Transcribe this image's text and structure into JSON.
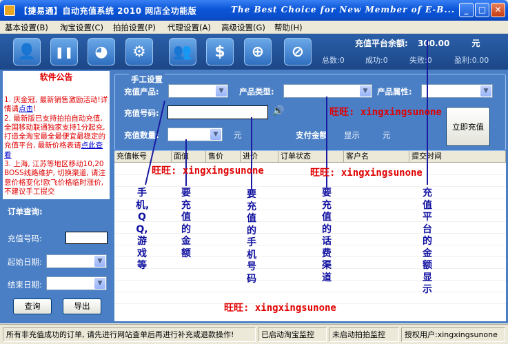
{
  "window": {
    "title": "【捷易通】自动充值系统 2010 网店全功能版",
    "tagline": "The Best Choice for New Member of E-B...",
    "min": "_",
    "max": "□",
    "close": "✕"
  },
  "menu": [
    "基本设置(B)",
    "淘宝设置(C)",
    "拍拍设置(P)",
    "代理设置(A)",
    "高级设置(G)",
    "帮助(H)"
  ],
  "toolbar": {
    "icons": [
      "user-icon",
      "pause-icon",
      "qq-icon",
      "settings-icon",
      "users-icon",
      "dollar-icon",
      "zoom-icon",
      "stop-icon"
    ],
    "glyphs": [
      "👤",
      "❚❚",
      "◕",
      "⚙",
      "👥",
      "$",
      "⊕",
      "⊘"
    ],
    "balance_label": "充值平台余额:",
    "balance_value": "300.00",
    "balance_unit": "元",
    "stats": [
      "总数:0",
      "成功:0",
      "失败:0",
      "盈利:0.00"
    ]
  },
  "notice": {
    "title": "软件公告",
    "line1a": "1. 庆金冠, 最新销售激励活动!详情请",
    "line1link": "点击",
    "line1b": "!",
    "line2a": "2. 最新版已支持拍拍自动充值,全国移动联通独家支持1分起充, 打造全淘宝最全最便宜最稳定的充值平台, 最新价格表请",
    "line2link": "点此查看",
    "line3": "3. 上海, 江苏等地区移动10,20 BOSS线路维护, 切换渠道, 请注意价格变化!欧飞价格临时涨价, 不建议手工提交"
  },
  "query": {
    "title": "订单查询:",
    "phone_label": "充值号码:",
    "start_label": "起始日期:",
    "end_label": "结束日期:",
    "search": "查询",
    "export": "导出"
  },
  "form": {
    "group_title": "手工设置",
    "product_label": "充值产品:",
    "type_label": "产品类型:",
    "attr_label": "产品属性:",
    "phone_label": "充值号码:",
    "qty_label": "充值数量:",
    "qty_unit": "元",
    "pay_label": "支付金额",
    "pay_show": "显示",
    "pay_unit": "元",
    "submit": "立即充值"
  },
  "table": {
    "columns": [
      "充值帐号",
      "面值",
      "售价",
      "进价",
      "订单状态",
      "客户名",
      "提交时间"
    ]
  },
  "annotations": {
    "wangwang1": "旺旺: xingxingsunone",
    "wangwang2": "旺旺: xingxingsunone",
    "wangwang3": "旺旺: xingxingsunone",
    "wangwang4": "旺旺: xingxingsunone",
    "v1": "手机,QQ,游戏等",
    "v2": "要充值的金额",
    "v3": "要充值的手机号码",
    "v4": "要充值的话费渠道",
    "v5": "充值平台的金额显示"
  },
  "status": {
    "message": "所有非充值成功的订单, 请先进行网站查单后再进行补充或退款操作!",
    "taobao": "已启动淘宝监控",
    "paipai": "未启动拍拍监控",
    "user": "授权用户:xingxingsunone"
  }
}
